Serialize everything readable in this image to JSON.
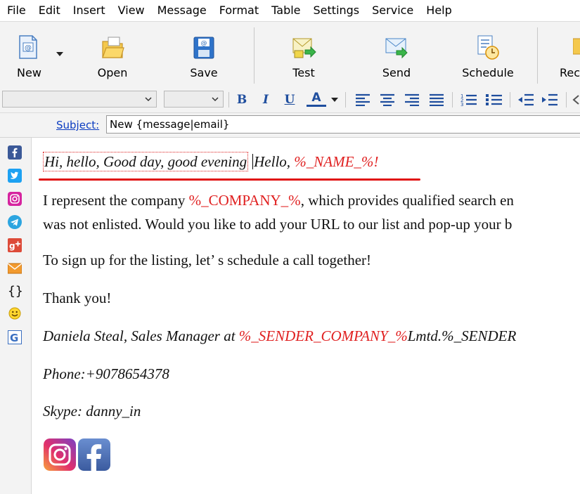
{
  "menu": [
    "File",
    "Edit",
    "Insert",
    "View",
    "Message",
    "Format",
    "Table",
    "Settings",
    "Service",
    "Help"
  ],
  "toolbar": {
    "new_label": "New",
    "open_label": "Open",
    "save_label": "Save",
    "test_label": "Test",
    "send_label": "Send",
    "schedule_label": "Schedule",
    "partial_label": "Rec"
  },
  "format": {
    "bold": "B",
    "italic": "I",
    "underline": "U",
    "color": "A"
  },
  "subject": {
    "label": "Subject:",
    "value": "New {message|email}"
  },
  "body": {
    "spintax": "Hi, hello, Good day, good evening",
    "greeting": "Hello, ",
    "name_var": "%_NAME_%",
    "greeting_end": "!",
    "p1_a": "I represent the company ",
    "company_var": "%_COMPANY_%",
    "p1_b": ", which provides qualified search en",
    "p1_line2": "was not enlisted. Would you like to add your URL to our list and pop-up your b",
    "p2": "To sign up for the listing, let’ s schedule a call together!",
    "p3": "Thank you!",
    "sig_a": "Daniela Steal, Sales Manager at ",
    "sender_company_var": "%_SENDER_COMPANY_%",
    "sig_b": "Lmtd.%_SENDER",
    "phone": "Phone:+9078654378",
    "skype": "Skype: danny_in"
  },
  "sidebar_icons": [
    "facebook-icon",
    "twitter-icon",
    "instagram-icon",
    "telegram-icon",
    "google-plus-icon",
    "email-icon",
    "braces-icon",
    "smiley-icon",
    "google-icon"
  ],
  "colors": {
    "accent_red": "#e02020",
    "link_blue": "#0b3cc1",
    "toolbar_bg": "#f3f3f3"
  }
}
